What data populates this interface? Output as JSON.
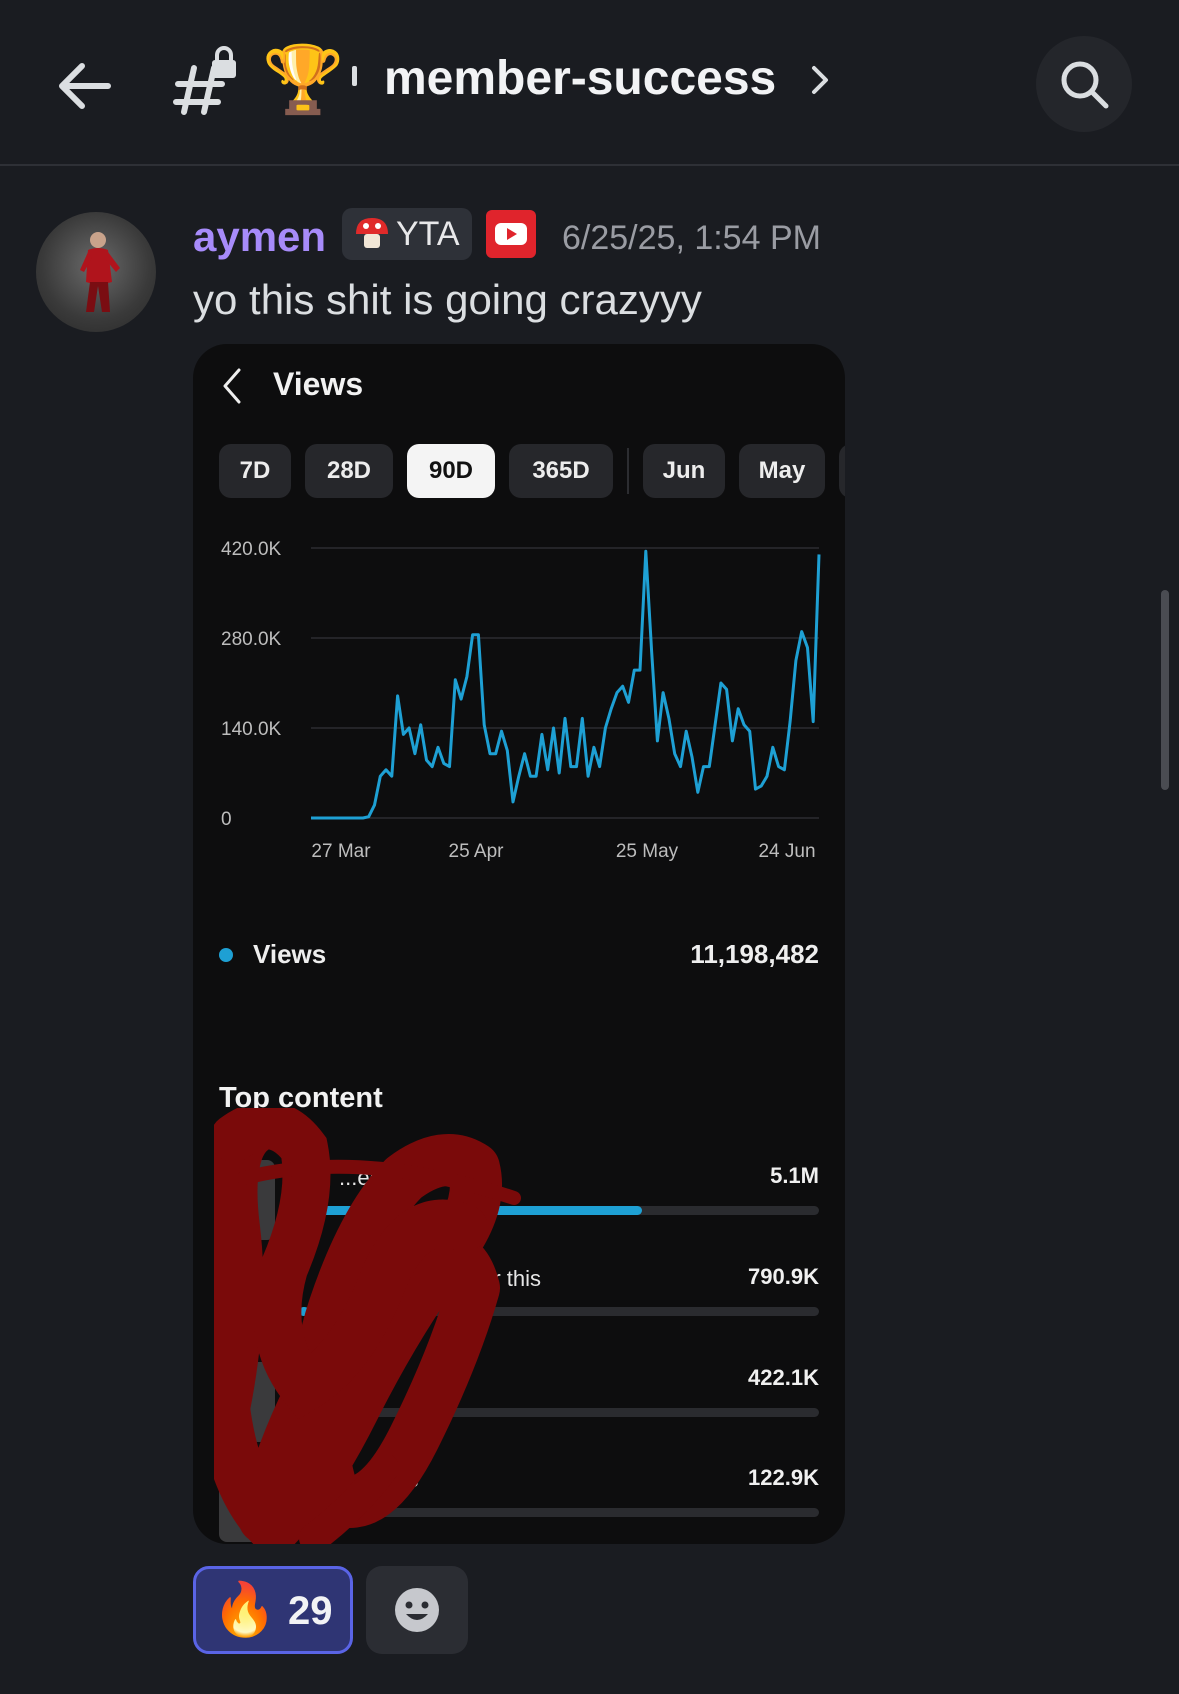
{
  "header": {
    "back_icon": "arrow-left-icon",
    "channel_icon": "locked-hash-icon",
    "emoji": "🏆",
    "channel_name": "member-success",
    "chevron_icon": "chevron-right-icon",
    "search_icon": "search-icon"
  },
  "message": {
    "username": "aymen",
    "username_color": "#a78bfa",
    "tag": "YTA",
    "tag_icon": "mushroom-icon",
    "badge_icon": "youtube-icon",
    "timestamp": "6/25/25, 1:54 PM",
    "text": "yo this shit is going crazyyy"
  },
  "attachment": {
    "title": "Views",
    "back_icon": "chevron-left-icon",
    "periods": [
      "7D",
      "28D",
      "90D",
      "365D",
      "Jun",
      "May"
    ],
    "active_period": "90D",
    "legend_label": "Views",
    "legend_value": "11,198,482",
    "top_content_title": "Top content",
    "top_content": [
      {
        "title": "...ed",
        "value": "5.1M",
        "share": 0.66
      },
      {
        "title": "for this",
        "value": "790.9K",
        "share": 0.02
      },
      {
        "title": "",
        "value": "422.1K",
        "share": 0.01
      },
      {
        "title": "mc",
        "value": "122.9K",
        "share": 0.004
      }
    ]
  },
  "chart_data": {
    "type": "line",
    "title": "",
    "xlabel": "",
    "ylabel": "",
    "x_tick_labels": [
      "27 Mar",
      "25 Apr",
      "25 May",
      "24 Jun"
    ],
    "y_tick_labels": [
      "0",
      "140.0K",
      "280.0K",
      "420.0K"
    ],
    "ylim": [
      0,
      420000
    ],
    "grid": true,
    "series": [
      {
        "name": "Views",
        "color": "#1ea0d4",
        "values": [
          0,
          0,
          0,
          0,
          0,
          0,
          0,
          0,
          0,
          0,
          2000,
          20000,
          65000,
          75000,
          65000,
          190000,
          130000,
          140000,
          100000,
          145000,
          90000,
          80000,
          110000,
          85000,
          80000,
          215000,
          185000,
          220000,
          285000,
          285000,
          145000,
          100000,
          100000,
          135000,
          105000,
          25000,
          65000,
          100000,
          65000,
          65000,
          130000,
          75000,
          140000,
          70000,
          155000,
          80000,
          80000,
          155000,
          65000,
          110000,
          80000,
          140000,
          170000,
          195000,
          205000,
          180000,
          230000,
          230000,
          415000,
          260000,
          120000,
          195000,
          155000,
          100000,
          80000,
          135000,
          95000,
          40000,
          80000,
          80000,
          145000,
          210000,
          200000,
          120000,
          170000,
          145000,
          135000,
          45000,
          50000,
          65000,
          110000,
          80000,
          75000,
          150000,
          245000,
          290000,
          265000,
          150000,
          410000
        ]
      }
    ]
  },
  "reactions": [
    {
      "emoji": "🔥",
      "count": "29",
      "active": true
    }
  ],
  "add_reaction_icon": "smiley-add-reaction-icon"
}
